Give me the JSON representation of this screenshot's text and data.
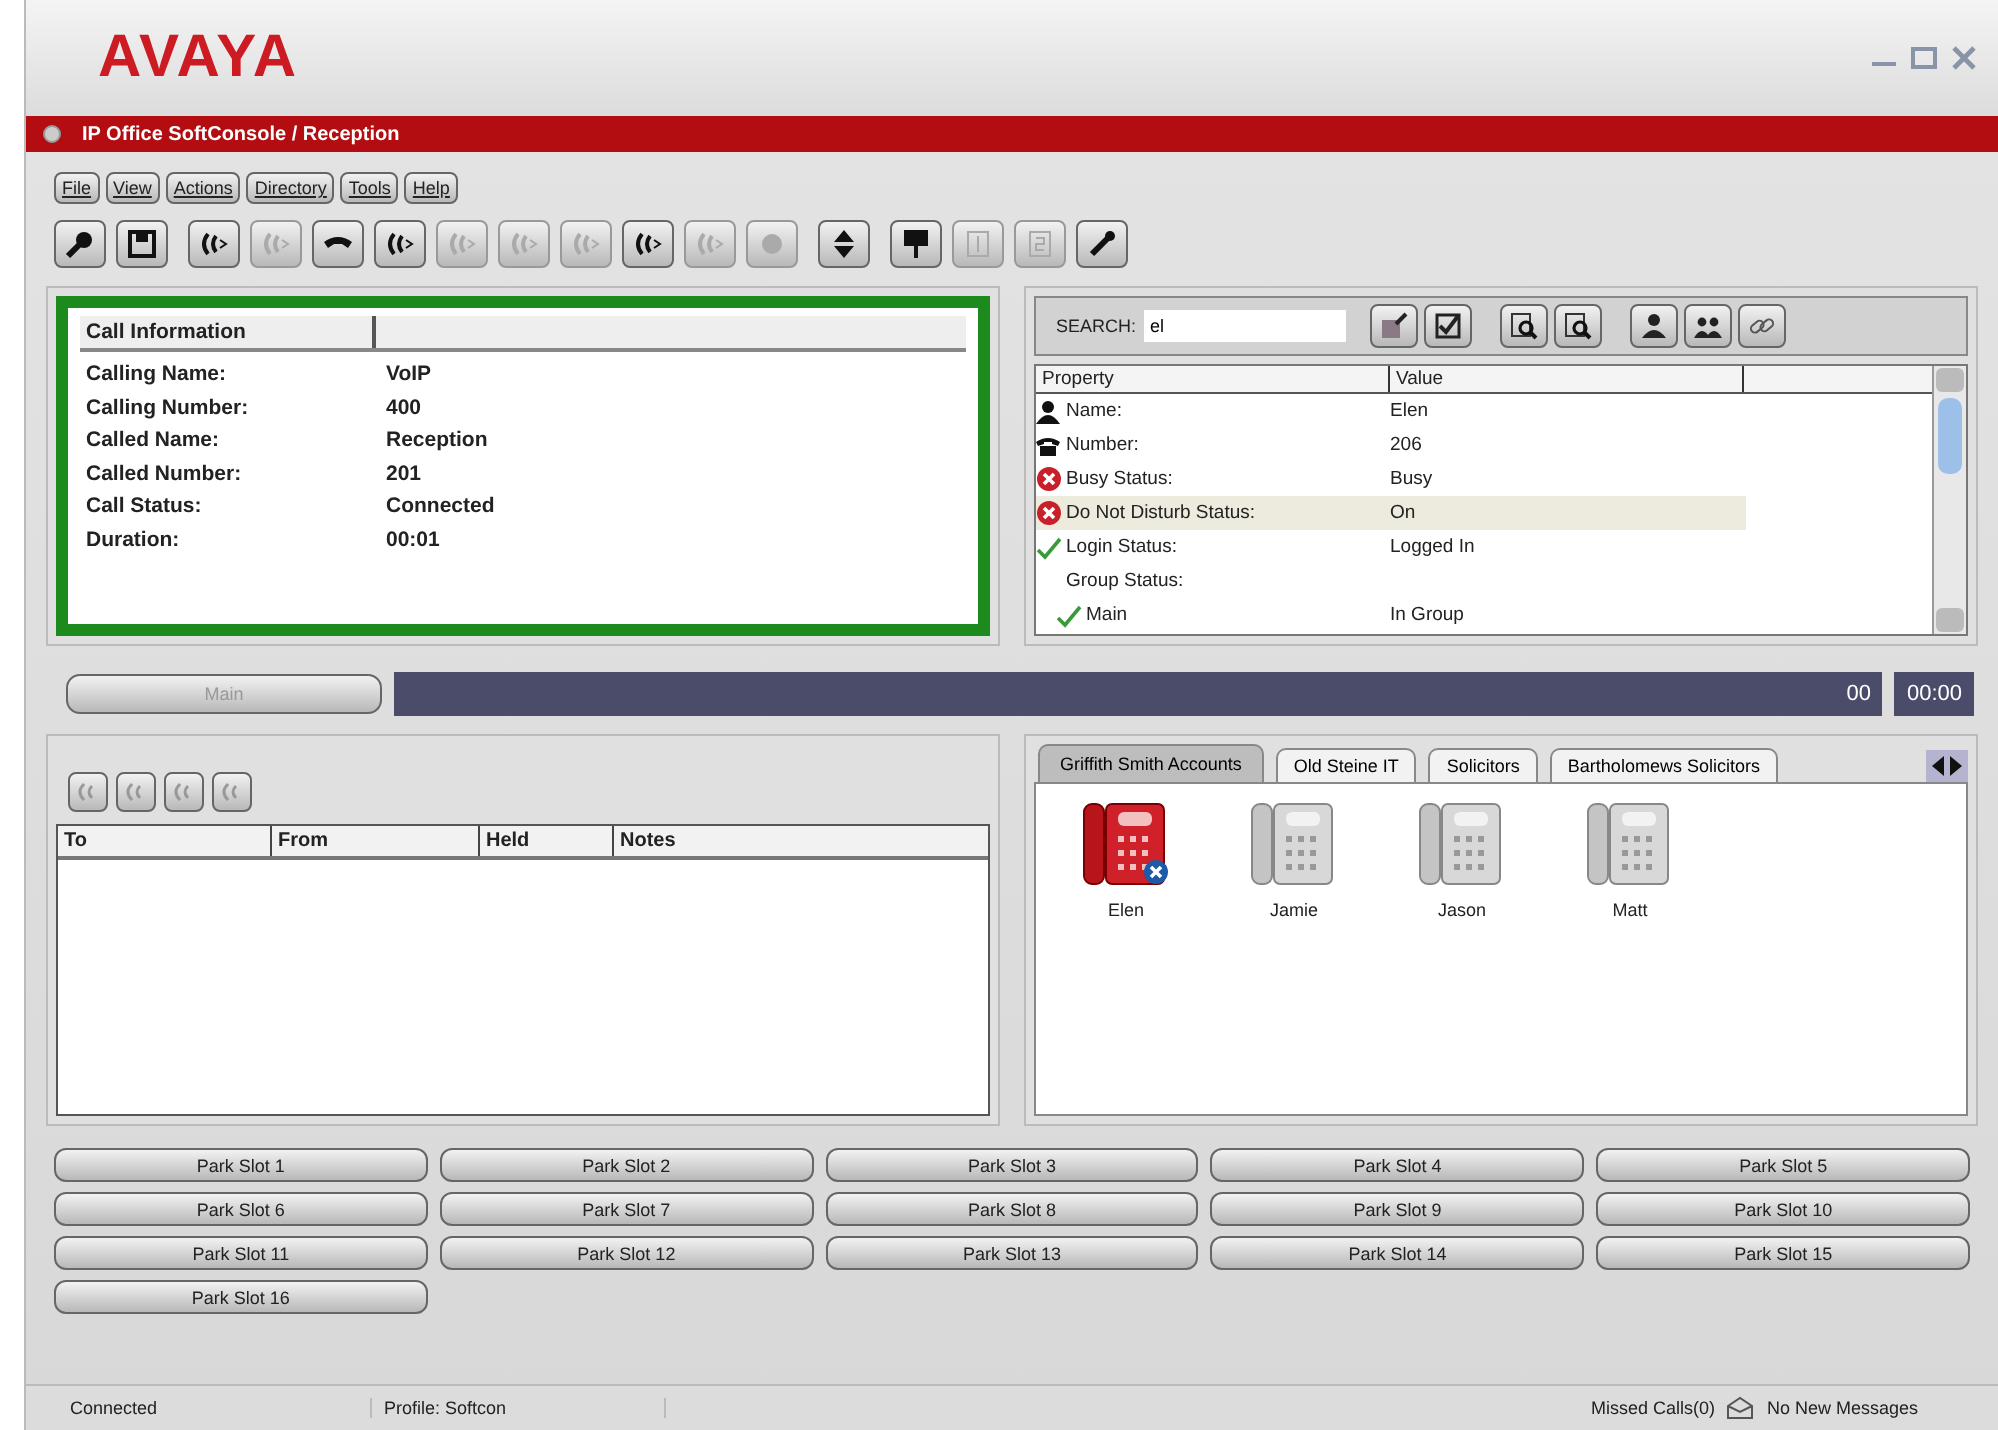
{
  "logo": "AVAYA",
  "window": {
    "title": "IP Office SoftConsole / Reception"
  },
  "menu": [
    "File",
    "View",
    "Actions",
    "Directory",
    "Tools",
    "Help"
  ],
  "toolbar": [
    [
      {
        "disabled": false
      },
      {
        "disabled": false
      }
    ],
    [
      {
        "disabled": false
      },
      {
        "disabled": true
      },
      {
        "disabled": false
      },
      {
        "disabled": false
      },
      {
        "disabled": true
      },
      {
        "disabled": true
      },
      {
        "disabled": true
      },
      {
        "disabled": false
      },
      {
        "disabled": true
      },
      {
        "disabled": true
      }
    ],
    [
      {
        "disabled": false
      }
    ],
    [
      {
        "disabled": false
      },
      {
        "disabled": true
      },
      {
        "disabled": true
      },
      {
        "disabled": false
      }
    ]
  ],
  "call_information": {
    "header": "Call Information",
    "rows": [
      {
        "label": "Calling Name:",
        "value": "VoIP"
      },
      {
        "label": "Calling Number:",
        "value": "400"
      },
      {
        "label": "Called Name:",
        "value": "Reception"
      },
      {
        "label": "Called Number:",
        "value": "201"
      },
      {
        "label": "Call Status:",
        "value": "Connected"
      },
      {
        "label": "Duration:",
        "value": "00:01"
      }
    ]
  },
  "directory": {
    "search_label": "SEARCH:",
    "search_value": "el",
    "columns": [
      "Property",
      "Value"
    ],
    "rows": [
      {
        "kind": "person",
        "property": "Name:",
        "value": "Elen",
        "selected": false
      },
      {
        "kind": "phone",
        "property": "Number:",
        "value": "206",
        "selected": false
      },
      {
        "kind": "error",
        "property": "Busy Status:",
        "value": "Busy",
        "selected": false
      },
      {
        "kind": "error",
        "property": "Do Not Disturb Status:",
        "value": "On",
        "selected": true
      },
      {
        "kind": "ok",
        "property": "Login Status:",
        "value": "Logged In",
        "selected": false
      },
      {
        "kind": "none",
        "property": "Group Status:",
        "selected": false,
        "children": [
          {
            "kind": "ok",
            "property": "Main",
            "value": "In Group",
            "selected": false
          }
        ]
      }
    ]
  },
  "queue": {
    "button": "Main",
    "count": "00",
    "time": "00:00"
  },
  "held_calls": {
    "columns": [
      "To",
      "From",
      "Held",
      "Notes"
    ]
  },
  "user_tabs": [
    {
      "label": "Griffith Smith Accounts",
      "selected": true
    },
    {
      "label": "Old Steine IT",
      "selected": false
    },
    {
      "label": "Solicitors",
      "selected": false
    },
    {
      "label": "Bartholomews Solicitors",
      "selected": false
    }
  ],
  "users": [
    {
      "name": "Elen",
      "busy": true
    },
    {
      "name": "Jamie",
      "busy": false
    },
    {
      "name": "Jason",
      "busy": false
    },
    {
      "name": "Matt",
      "busy": false
    }
  ],
  "park_slots": [
    "Park Slot 1",
    "Park Slot 2",
    "Park Slot 3",
    "Park Slot 4",
    "Park Slot 5",
    "Park Slot 6",
    "Park Slot 7",
    "Park Slot 8",
    "Park Slot 9",
    "Park Slot 10",
    "Park Slot 11",
    "Park Slot 12",
    "Park Slot 13",
    "Park Slot 14",
    "Park Slot 15",
    "Park Slot 16"
  ],
  "status_bar": {
    "connection": "Connected",
    "profile": "Profile: Softcon",
    "missed_calls": "Missed Calls(0)",
    "messages": "No New Messages"
  }
}
